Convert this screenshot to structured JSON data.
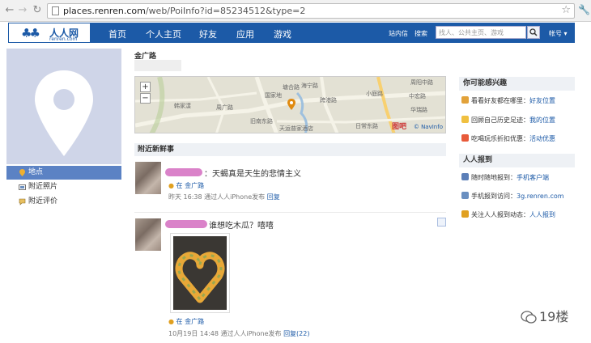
{
  "browser": {
    "url_host": "places.renren.com",
    "url_path": "/web/PoiInfo?id=85234512&type=2",
    "back_icon": "back-arrow-icon",
    "forward_icon": "forward-arrow-icon",
    "reload_icon": "reload-icon",
    "star_icon": "bookmark-star-icon",
    "wrench_icon": "wrench-icon"
  },
  "header": {
    "logo_text": "人人网",
    "logo_sub": "renren.com",
    "nav": [
      "首页",
      "个人主页",
      "好友",
      "应用",
      "游戏"
    ],
    "inbox": "站内信",
    "search_label": "搜索",
    "search_placeholder": "找人、公共主页、游戏",
    "account": "帐号"
  },
  "sidebar": {
    "items": [
      {
        "label": "地点",
        "icon": "location-pin-icon",
        "active": true
      },
      {
        "label": "附近照片",
        "icon": "photo-icon",
        "active": false
      },
      {
        "label": "附近评价",
        "icon": "comment-icon",
        "active": false
      }
    ]
  },
  "place": {
    "title": "金广路"
  },
  "map": {
    "labels": [
      "韩家漾",
      "周广路",
      "国家地",
      "海宁路",
      "跨港路",
      "塘合路",
      "小庭路",
      "周阳中路",
      "天运普家酒店",
      "旧南东路",
      "中宏路",
      "华瑞路",
      "日常东路"
    ],
    "zoom_in": "+",
    "zoom_out": "−",
    "tupian": "图吧",
    "brand": "© NavInfo"
  },
  "nearby": {
    "title": "附近新鲜事",
    "posts": [
      {
        "text": "：天蝎真是天生的悲情主义",
        "location": "在 金广路",
        "meta": "昨天 16:38 通过人人iPhone发布",
        "reply": "回复"
      },
      {
        "text": "谁想吃木瓜？嘻嘻",
        "location": "在 金广路",
        "meta": "10月19日 14:48 通过人人iPhone发布",
        "reply": "回复(22)"
      }
    ]
  },
  "right": {
    "interest_title": "你可能感兴趣",
    "interest_items": [
      {
        "text": "看看好友都在哪里：",
        "link": "好友位置",
        "color": "#e2a23a"
      },
      {
        "text": "回顾自己历史足迹：",
        "link": "我的位置",
        "color": "#f0c040"
      },
      {
        "text": "吃喝玩乐折扣优惠：",
        "link": "活动优惠",
        "color": "#e85a3a"
      }
    ],
    "checkin_title": "人人报到",
    "checkin_items": [
      {
        "text": "随时随地报到：",
        "link": "手机客户端",
        "color": "#5b7fb8"
      },
      {
        "text": "手机报到访问：",
        "link": "3g.renren.com",
        "color": "#6a8fc0"
      },
      {
        "text": "关注人人报到动态：",
        "link": "人人报到",
        "color": "#e0a020"
      }
    ]
  },
  "watermark": {
    "text": "19楼"
  }
}
